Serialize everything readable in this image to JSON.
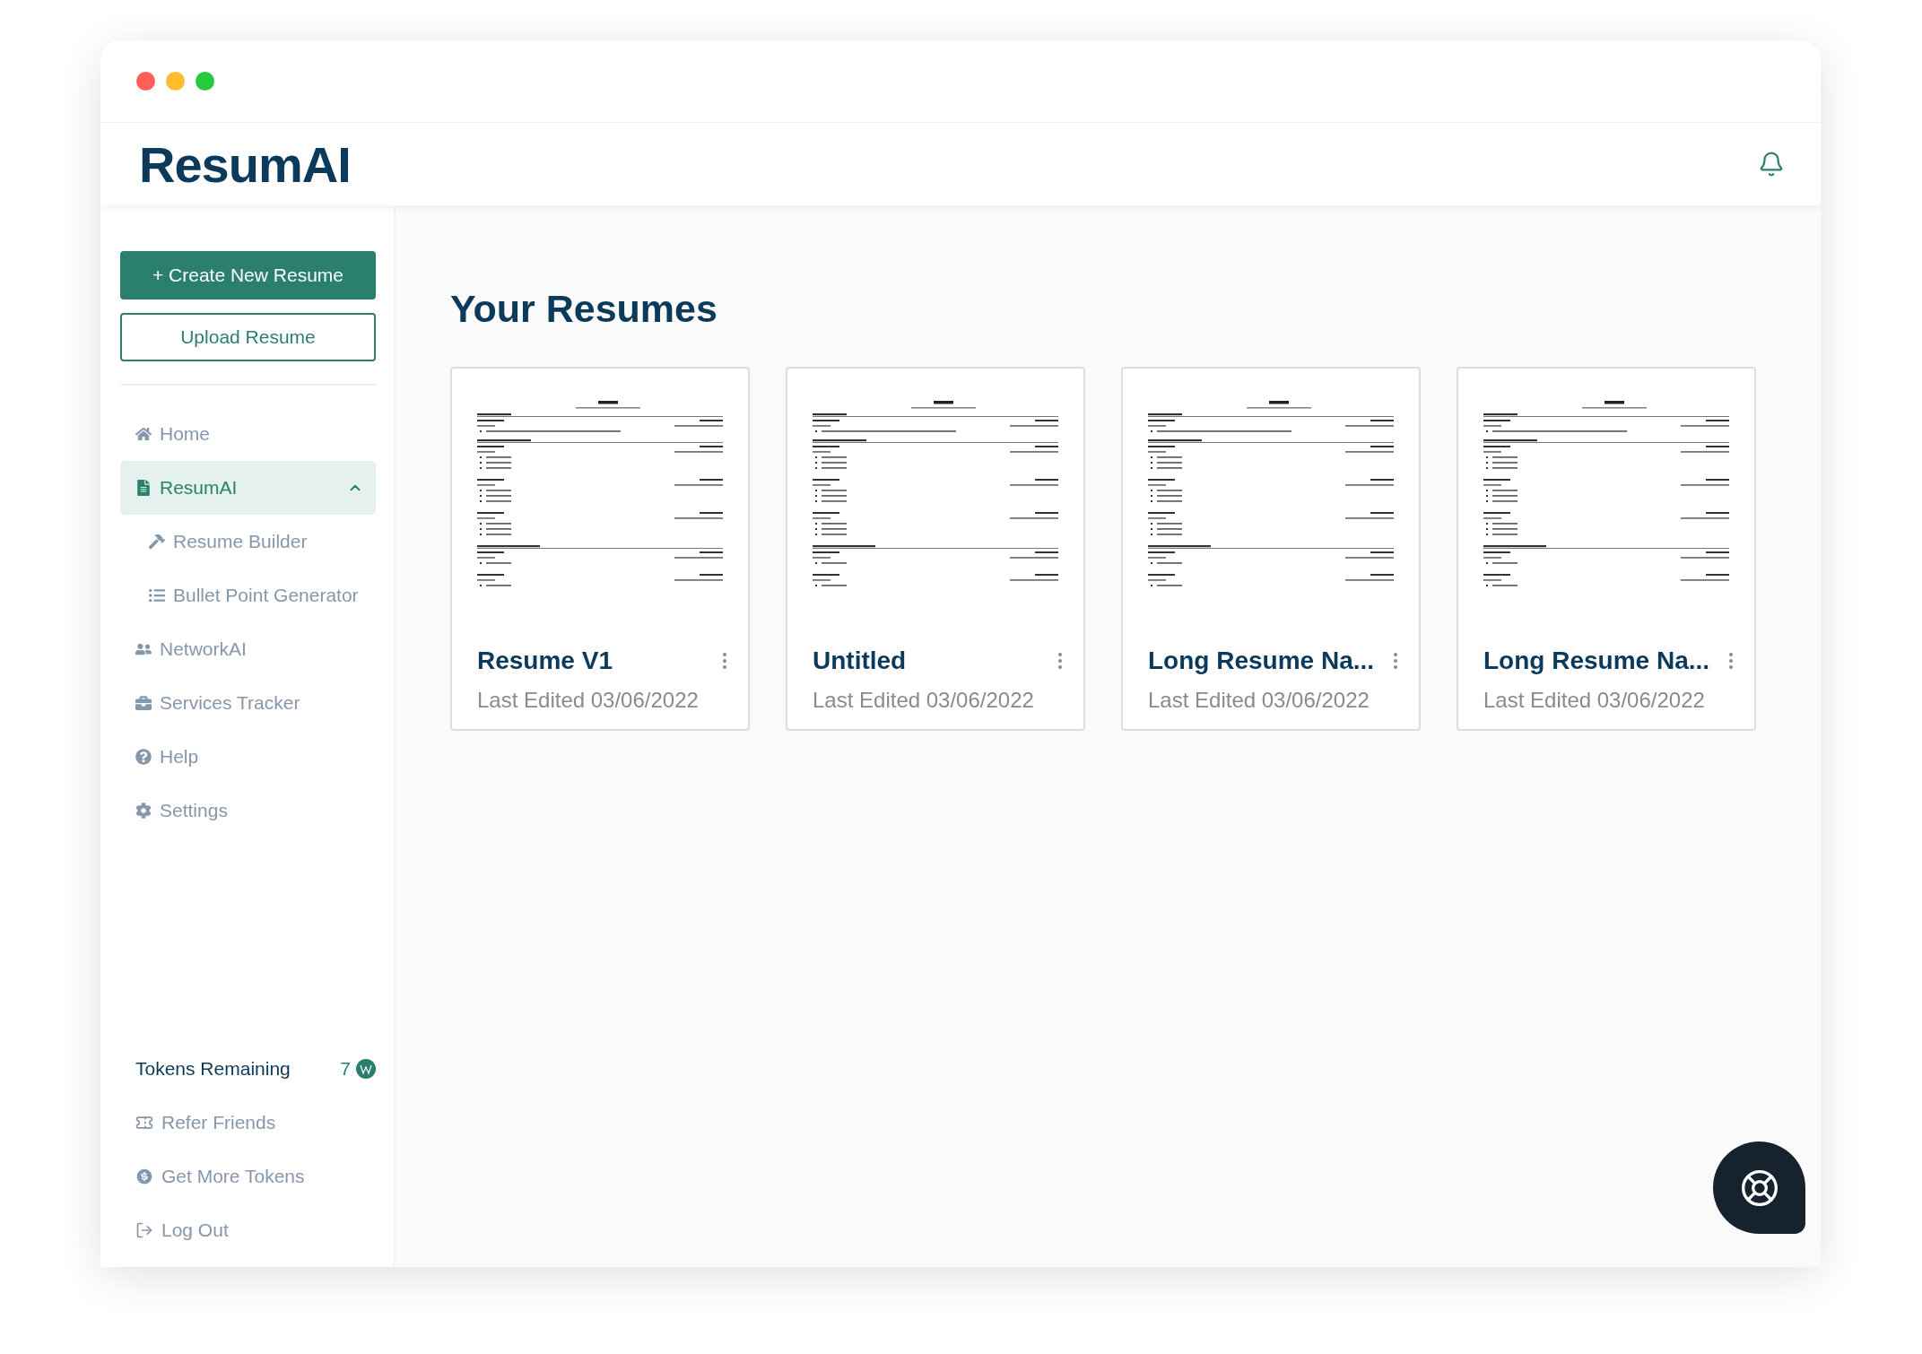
{
  "window": {
    "controls": [
      {
        "color": "#ff5f57"
      },
      {
        "color": "#febc2e"
      },
      {
        "color": "#28c840"
      }
    ]
  },
  "header": {
    "logo": "ResumAI"
  },
  "sidebar": {
    "primary_button": "+ Create New Resume",
    "secondary_button": "Upload Resume",
    "nav": [
      {
        "label": "Home",
        "selected": false
      },
      {
        "label": "ResumAI",
        "selected": true,
        "expanded": true,
        "children": [
          {
            "label": "Resume Builder",
            "selected": false
          },
          {
            "label": "Bullet Point Generator",
            "selected": false
          }
        ]
      },
      {
        "label": "NetworkAI",
        "selected": false
      },
      {
        "label": "Services Tracker",
        "selected": false
      },
      {
        "label": "Help",
        "selected": false
      },
      {
        "label": "Settings",
        "selected": false
      }
    ],
    "tokens": {
      "label": "Tokens Remaining",
      "count": "7"
    },
    "footer_links": [
      "Refer Friends",
      "Get More Tokens",
      "Log Out"
    ]
  },
  "main": {
    "title": "Your Resumes",
    "resumes": [
      {
        "title": "Resume V1",
        "edited": "Last Edited 03/06/2022"
      },
      {
        "title": "Untitled",
        "edited": "Last Edited 03/06/2022"
      },
      {
        "title": "Long Resume Na...",
        "edited": "Last Edited 03/06/2022"
      },
      {
        "title": "Long Resume Na...",
        "edited": "Last Edited 03/06/2022"
      }
    ]
  }
}
